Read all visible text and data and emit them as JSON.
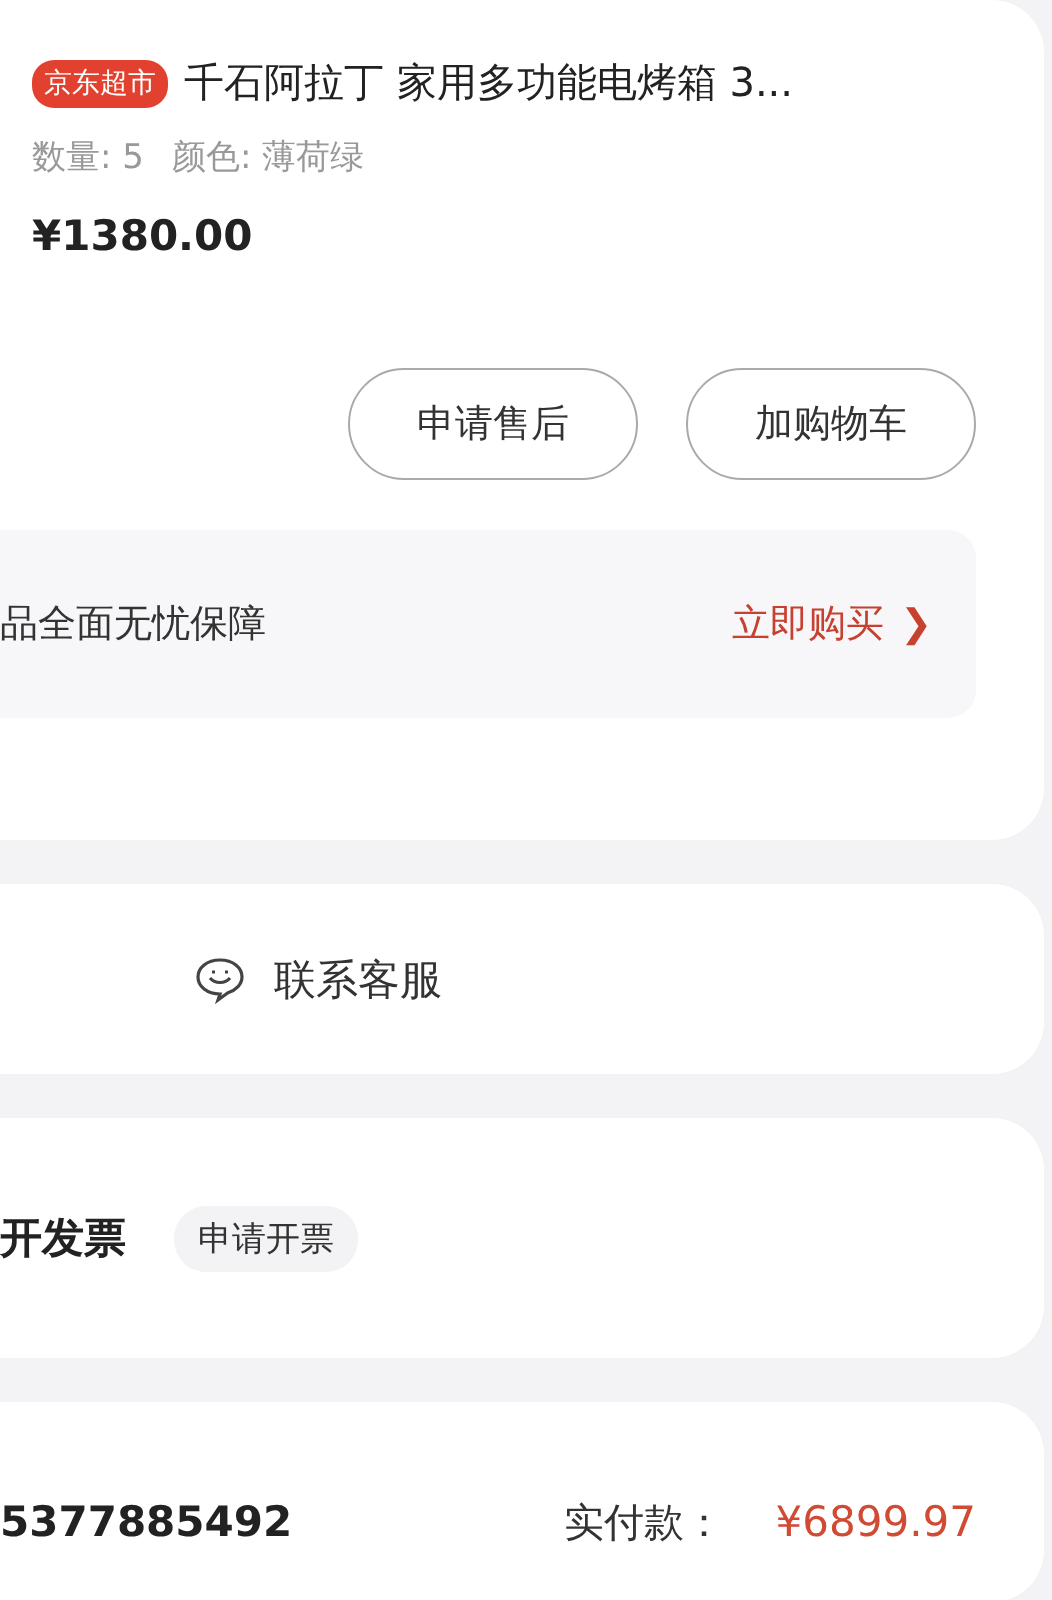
{
  "product": {
    "store_badge": "京东超市",
    "title": "千石阿拉丁 家用多功能电烤箱 3...",
    "specs": [
      "数量: 5",
      "颜色: 薄荷绿"
    ],
    "price": "¥1380.00",
    "actions": [
      "申请售后",
      "加购物车"
    ],
    "guarantee": {
      "text": "品全面无忧保障",
      "link": "立即购买",
      "arrow": "❯"
    }
  },
  "service": {
    "label": "联系客服"
  },
  "invoice": {
    "status": "开发票",
    "action": "申请开票"
  },
  "payment": {
    "order_number": "5377885492",
    "label": "实付款：",
    "amount": "¥6899.97"
  }
}
